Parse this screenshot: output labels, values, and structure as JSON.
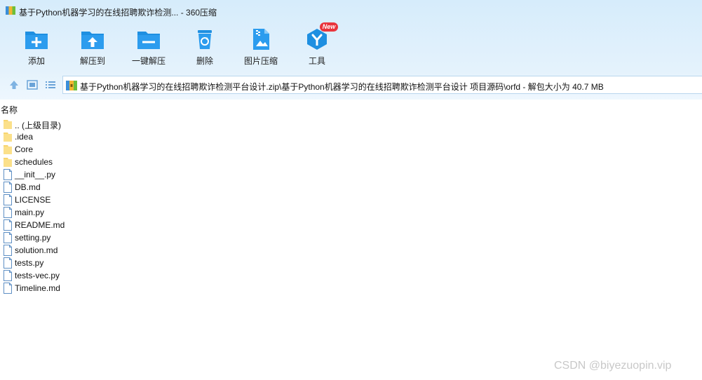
{
  "window": {
    "title": "基于Python机器学习的在线招聘欺诈检测... - 360压缩"
  },
  "toolbar": {
    "add": "添加",
    "extract_to": "解压到",
    "one_click_extract": "一键解压",
    "delete": "删除",
    "image_compress": "图片压缩",
    "tools": "工具",
    "new_badge": "New"
  },
  "address": {
    "path": "基于Python机器学习的在线招聘欺诈检测平台设计.zip\\基于Python机器学习的在线招聘欺诈检测平台设计 项目源码\\orfd - 解包大小为 40.7 MB"
  },
  "list_header": {
    "name": "名称"
  },
  "files": [
    {
      "name": ".. (上级目录)",
      "type": "folder"
    },
    {
      "name": ".idea",
      "type": "folder"
    },
    {
      "name": "Core",
      "type": "folder"
    },
    {
      "name": "schedules",
      "type": "folder"
    },
    {
      "name": "__init__.py",
      "type": "file"
    },
    {
      "name": "DB.md",
      "type": "file"
    },
    {
      "name": "LICENSE",
      "type": "file"
    },
    {
      "name": "main.py",
      "type": "file"
    },
    {
      "name": "README.md",
      "type": "file"
    },
    {
      "name": "setting.py",
      "type": "file"
    },
    {
      "name": "solution.md",
      "type": "file"
    },
    {
      "name": "tests.py",
      "type": "file"
    },
    {
      "name": "tests-vec.py",
      "type": "file"
    },
    {
      "name": "Timeline.md",
      "type": "file"
    }
  ],
  "watermark": "CSDN @biyezuopin.vip",
  "colors": {
    "accent": "#1e8fe1",
    "folder": "#f7d56f",
    "badge": "#e9343c"
  }
}
